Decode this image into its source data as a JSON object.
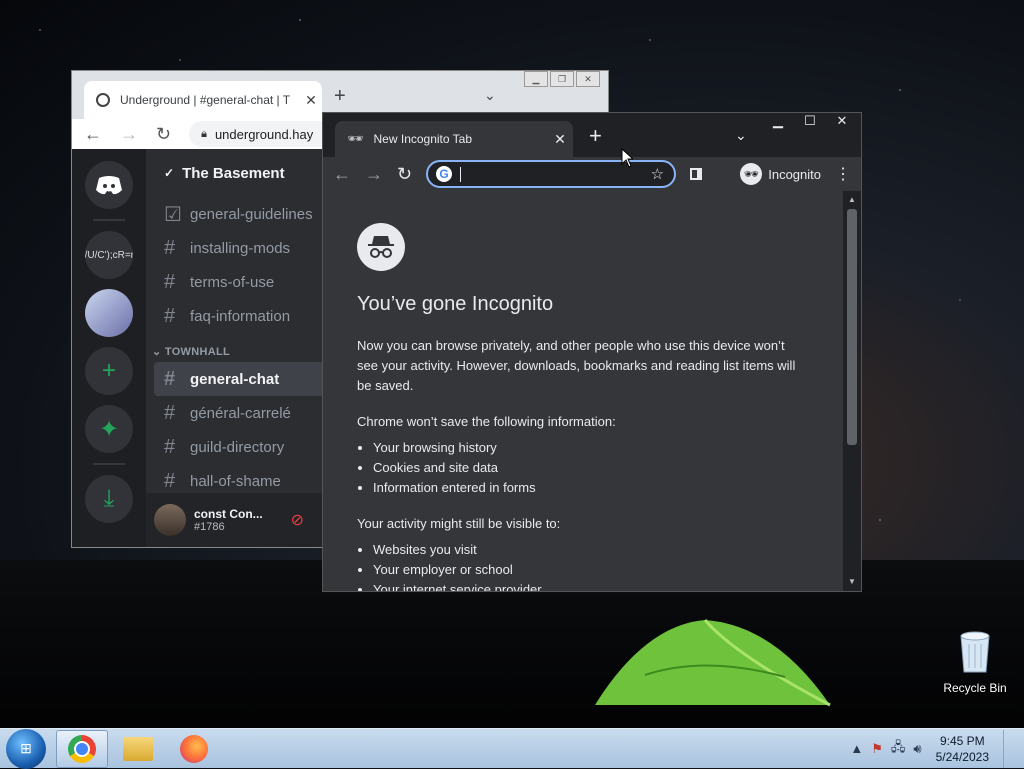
{
  "desktop": {
    "recycle_bin_label": "Recycle Bin"
  },
  "discord_window": {
    "tab_title": "Underground | #general-chat | T",
    "address": "underground.hay",
    "server_name": "The Basement",
    "guild_partial_text": "./U/C');cR=n",
    "channels_top": [
      {
        "icon": "rules-icon",
        "label": "general-guidelines"
      },
      {
        "icon": "hash-icon",
        "label": "installing-mods"
      },
      {
        "icon": "hash-icon",
        "label": "terms-of-use"
      },
      {
        "icon": "hash-icon",
        "label": "faq-information"
      }
    ],
    "category": "TOWNHALL",
    "channels_townhall": [
      {
        "label": "general-chat",
        "active": true
      },
      {
        "label": "général-carrelé",
        "active": false
      },
      {
        "label": "guild-directory",
        "active": false
      },
      {
        "label": "hall-of-shame",
        "active": false
      }
    ],
    "user": {
      "name": "const Con...",
      "tag": "#1786"
    }
  },
  "incognito_window": {
    "tab_title": "New Incognito Tab",
    "omnibox_value": "",
    "profile_label": "Incognito",
    "heading": "You’ve gone Incognito",
    "intro": "Now you can browse privately, and other people who use this device won’t see your activity. However, downloads, bookmarks and reading list items will be saved.",
    "wont_save_heading": "Chrome won’t save the following information:",
    "wont_save_items": [
      "Your browsing history",
      "Cookies and site data",
      "Information entered in forms"
    ],
    "visible_heading": "Your activity might still be visible to:",
    "visible_items": [
      "Websites you visit",
      "Your employer or school",
      "Your internet service provider"
    ]
  },
  "taskbar": {
    "time": "9:45 PM",
    "date": "5/24/2023"
  },
  "colors": {
    "discord_bg": "#2b2d31",
    "discord_rail": "#1e1f22",
    "incognito_bg": "#35363a",
    "focus_ring": "#8ab4f8",
    "taskbar": "#b5cbe4"
  }
}
